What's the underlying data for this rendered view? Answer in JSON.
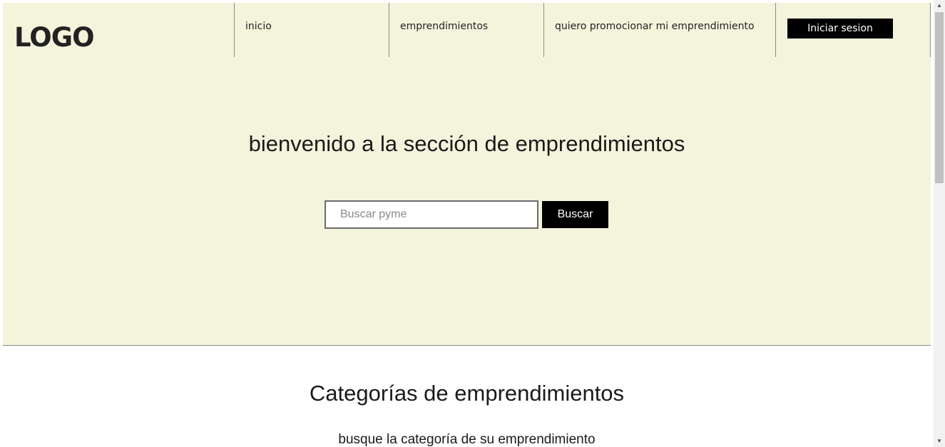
{
  "header": {
    "logo": "LOGO",
    "nav": [
      {
        "label": "inicio"
      },
      {
        "label": "emprendimientos"
      },
      {
        "label": "quiero promocionar mi emprendimiento"
      }
    ],
    "login_label": "Iniciar sesion"
  },
  "hero": {
    "title": "bienvenido a la sección de emprendimientos",
    "search": {
      "placeholder": "Buscar pyme",
      "value": "",
      "button_label": "Buscar"
    }
  },
  "categories": {
    "title": "Categorías de emprendimientos",
    "subtitle": "busque la categoría de su emprendimiento"
  },
  "scrollbar": {
    "up_icon": "▲",
    "down_icon": "▼"
  },
  "colors": {
    "hero_background": "#f4f4dc",
    "button_background": "#000000"
  }
}
